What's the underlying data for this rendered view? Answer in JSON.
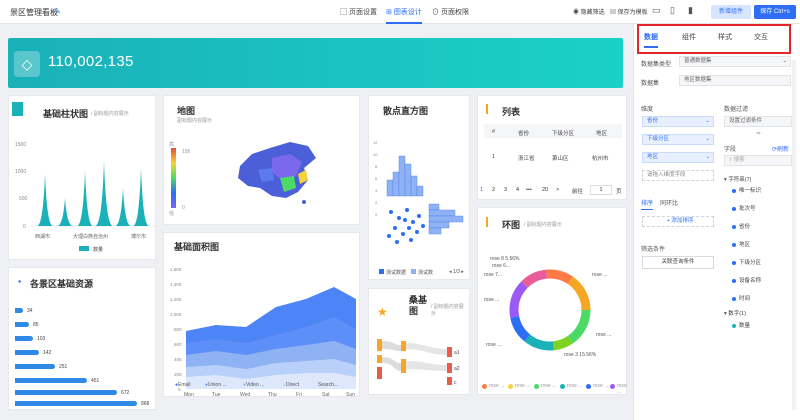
{
  "topbar": {
    "title": "景区管理看板",
    "tabs": [
      "页面设置",
      "图表设计",
      "页面权限"
    ],
    "active_tab": 1,
    "hide_filter": "隐藏筛选",
    "save_template": "保存为模板",
    "add_component": "新增组件",
    "save": "保存 Ctrl+s"
  },
  "banner": {
    "value": "110,002,135"
  },
  "bar_card": {
    "title": "基础柱状图",
    "subtitle": "/ 副标题内容展示",
    "ylabels": [
      "1500",
      "1000",
      "500",
      "0"
    ],
    "xlabels": [
      "西湖市",
      "大理白族自治州",
      "博尔市"
    ],
    "legend": "数量"
  },
  "map_card": {
    "title": "地图",
    "subtitle": "副标题内容展示",
    "scale_high": "高",
    "scale_max": "199",
    "scale_low": "低",
    "scale_min": "0"
  },
  "scatter_card": {
    "title": "散点直方图",
    "legend": [
      "测试数据",
      "测试数"
    ],
    "pager": "1/3",
    "yticks": [
      "12",
      "10",
      "8",
      "6",
      "4",
      "2",
      "0"
    ]
  },
  "table_card": {
    "title": "列表",
    "headers": [
      "#",
      "省份",
      "下级分区",
      "地区"
    ],
    "rows": [
      [
        "1",
        "浙江省",
        "萧山区",
        "杭州市"
      ]
    ],
    "pagination": [
      "1",
      "2",
      "3",
      "4",
      "•••",
      "20"
    ],
    "next": ">",
    "goto": "前往",
    "page": "1",
    "page_unit": "页"
  },
  "ring_card": {
    "title": "环图",
    "subtitle": "/ 副标题内容展示",
    "label_top": "rose 8 5.56%",
    "label_rose6": "rose 6...",
    "label_rose7": "rose 7...",
    "label_rose2": "rose ...",
    "label_rose1": "rose ...",
    "label_bottom": "rose 3 15.56%",
    "right_labels": [
      "rose ...",
      "rose ..."
    ],
    "legend": [
      "rose ...",
      "rose ...",
      "rose ...",
      "rose ...",
      "rose ...",
      "rose ..."
    ],
    "colors": [
      "#f5a623",
      "#4cd964",
      "#7ed321",
      "#1ab1b9",
      "#2e6ef5",
      "#9b59f5",
      "#e85d9a",
      "#ff7a45"
    ]
  },
  "resource_card": {
    "title": "各景区基础资源",
    "values": [
      "34",
      "85",
      "103",
      "142",
      "251",
      "451",
      "672",
      "868"
    ]
  },
  "area_card": {
    "title": "基础面积图",
    "yticks": [
      "1,600",
      "1,400",
      "1,200",
      "1,000",
      "800",
      "600",
      "400",
      "200",
      "0"
    ],
    "xticks": [
      "Mon",
      "Tue",
      "Wed",
      "Thu",
      "Fri",
      "Sat",
      "Sun"
    ],
    "legend": [
      "Email",
      "Union ...",
      "Video ...",
      "Direct",
      "Search..."
    ]
  },
  "sankey_card": {
    "title": "桑基图",
    "subtitle": "/ 副标题内容展示",
    "nodes": [
      "a1",
      "a2",
      "c"
    ]
  },
  "panel": {
    "tabs": [
      "数据",
      "组件",
      "样式",
      "交互"
    ],
    "active_tab": 0,
    "dataset_type_label": "数据集类型",
    "dataset_type_value": "普通数据集",
    "dataset_label": "数据集",
    "dataset_value": "地区数据集",
    "dimension_label": "维度",
    "dimensions": [
      "省份",
      "下级分区",
      "地区"
    ],
    "drop_hint": "请拖入维度字段",
    "sort_tabs": [
      "排序",
      "同环比"
    ],
    "add_sort": "+ 添加排序",
    "filter_label": "筛选条件",
    "filter_btn": "关联查询条件",
    "data_filter_label": "数据过滤",
    "data_filter_value": "设置过滤条件",
    "field_label": "字段",
    "refresh": "刷新",
    "search_placeholder": "搜索",
    "string_group": "字符串(7)",
    "string_fields": [
      "唯一标识",
      "批次号",
      "省份",
      "地区",
      "下级分区",
      "设备名称",
      "时间"
    ],
    "number_group": "数字(1)",
    "number_fields": [
      "数量"
    ]
  }
}
